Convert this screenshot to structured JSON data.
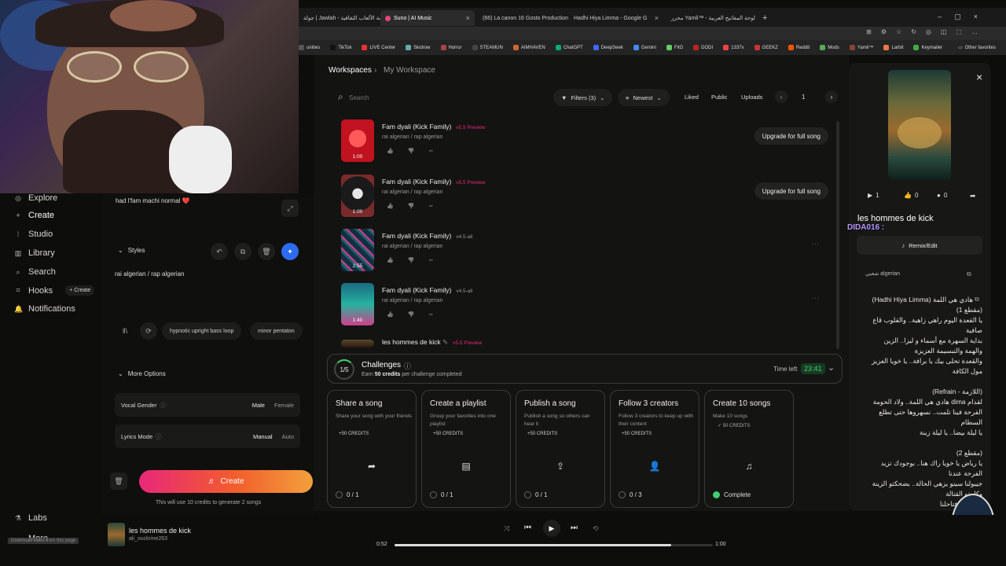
{
  "browser": {
    "tabs": [
      {
        "label": "جولة | Jawlah - منصة الألعاب الثقافية",
        "active": false
      },
      {
        "label": "Suno | AI Music",
        "active": true
      },
      {
        "label": "(66) La canon 16 Gosto Production",
        "active": false
      },
      {
        "label": "Hadhi Hiya Limma - Google G",
        "active": false
      },
      {
        "label": "محرر Yamli™ - لوحة المفاتيح العربية",
        "active": false
      }
    ],
    "bookmarks": [
      "unities",
      "TikTok",
      "LIVE Center",
      "Skidrow",
      "Horror",
      "STEAMUN",
      "AIMHAVEN",
      "ChatGPT",
      "DeepSeek",
      "Gemini",
      "FitG",
      "DODI",
      "1337x",
      "GEEKZ",
      "Reddit",
      "Mods",
      "Yamli™",
      "Larbit",
      "Keymailer"
    ],
    "bookmark_other": "Other favorites"
  },
  "nav": {
    "items": [
      {
        "label": "Explore",
        "icon": "compass-icon"
      },
      {
        "label": "Create",
        "icon": "plus-icon"
      },
      {
        "label": "Studio",
        "icon": "sliders-icon"
      },
      {
        "label": "Library",
        "icon": "library-icon"
      },
      {
        "label": "Search",
        "icon": "search-icon"
      },
      {
        "label": "Hooks",
        "icon": "hook-icon"
      },
      {
        "label": "Notifications",
        "icon": "bell-icon"
      }
    ],
    "hooks_create": "+ Create",
    "labs": "Labs",
    "more": "More",
    "download_hint": "Download video from this page"
  },
  "create": {
    "lyrics_snippet": "had l'fam machi normal ❤️",
    "styles_label": "Styles",
    "styles_value": "rai algerian / rap algerian",
    "tag_chips": [
      "hypnotic upright bass loop",
      "minor pentaton"
    ],
    "more_options": "More Options",
    "vocal_gender_label": "Vocal Gender",
    "vocal_male": "Male",
    "vocal_female": "Female",
    "lyrics_mode_label": "Lyrics Mode",
    "lyrics_manual": "Manual",
    "lyrics_auto": "Auto",
    "create_button": "Create",
    "credits_note": "This will use 10 credits to generate 2 songs"
  },
  "workspace": {
    "breadcrumb_root": "Workspaces",
    "breadcrumb_current": "My Workspace",
    "search_placeholder": "Search",
    "filters": "Filters (3)",
    "sort": "Newest",
    "liked": "Liked",
    "public": "Public",
    "uploads": "Uploads",
    "page": "1",
    "songs": [
      {
        "title": "Fam dyali (Kick Family)",
        "version": "v5.5 Preview",
        "genre": "rai algerian / rap algerian",
        "duration": "1:00",
        "upgrade": "Upgrade for full song"
      },
      {
        "title": "Fam dyali (Kick Family)",
        "version": "v5.5 Preview",
        "genre": "rai algerian / rap algerian",
        "duration": "1:00",
        "upgrade": "Upgrade for full song"
      },
      {
        "title": "Fam dyali (Kick Family)",
        "version": "v4.5-all",
        "genre": "rai algerian / rap algerian",
        "duration": "2:55",
        "upgrade": ""
      },
      {
        "title": "Fam dyali (Kick Family)",
        "version": "v4.5-all",
        "genre": "rai algerian / rap algerian",
        "duration": "1:40",
        "upgrade": ""
      },
      {
        "title": "les hommes de kick",
        "version": "v5.5 Preview",
        "genre": "",
        "duration": "",
        "upgrade": ""
      }
    ]
  },
  "challenges": {
    "progress": "1/5",
    "title": "Challenges",
    "subtitle_pre": "Earn ",
    "subtitle_bold": "50 credits",
    "subtitle_post": " per challenge completed",
    "time_left_label": "Time left",
    "time_left": "23:41",
    "cards": [
      {
        "title": "Share a song",
        "desc": "Share your song with your friends",
        "credits": "+50 CREDITS",
        "progress": "0 / 1",
        "icon": "share-icon",
        "glyph": "➦"
      },
      {
        "title": "Create a playlist",
        "desc": "Group your favorites into one playlist",
        "credits": "+50 CREDITS",
        "progress": "0 / 1",
        "icon": "playlist-icon",
        "glyph": "▤"
      },
      {
        "title": "Publish a song",
        "desc": "Publish a song so others can hear it",
        "credits": "+50 CREDITS",
        "progress": "0 / 1",
        "icon": "upload-icon",
        "glyph": "⇪"
      },
      {
        "title": "Follow 3 creators",
        "desc": "Follow 3 creators to keep up with their content",
        "credits": "+50 CREDITS",
        "progress": "0 / 3",
        "icon": "add-user-icon",
        "glyph": "👤"
      },
      {
        "title": "Create 10 songs",
        "desc": "Make 10 songs",
        "credits": "✓ 50 CREDITS",
        "progress": "Complete",
        "icon": "music-note-icon",
        "glyph": "♫"
      }
    ]
  },
  "detail": {
    "plays": "1",
    "likes": "0",
    "comments": "0",
    "title": "les hommes de kick",
    "overlay_user": "DIDA016 :",
    "remix": "Remix/Edit",
    "style_tag": "شعبي algerian",
    "lyrics": [
      "هادي هي اللمة (Hadhi Hiya Limma)",
      "(مقطع 1)",
      "يا القعدة اليوم راهي زاهية.. والقلوب قاع",
      "صافية",
      "بداية السهرة مع أسماء و ليزا.. الزين",
      "والهمة والتبسيمة العزيزة",
      "والقعدة تحلى بيك يا برافة.. يا خويا العزيز",
      "مول الكافة",
      "",
      "(اللازمة - Refrain)",
      "لقدام dima هادي هي اللمة.. ولاد الحومة",
      "الفرحة فينا تلمت.. نسهروها حتى تطلع",
      "السطام",
      "يا ليلة بيضا.. يا ليلة زينة",
      "",
      "(مقطع 2)",
      "يا رياض يا خويا راك هنا.. بوجودك تزيد",
      "الفرحة عندنا",
      "جيبولنا سينو يزهي الحالة.. بضحكتو الزينة",
      "وكلمتو القتالة",
      "MMA ... فتاحلنا"
    ]
  },
  "player": {
    "title": "les hommes de kick",
    "artist": "ali_ouckrine263",
    "current_time": "0:52",
    "total_time": "1:00",
    "progress": 0.87
  },
  "colors": {
    "accent_orange": "#f25d2c",
    "accent_pink": "#e8287a",
    "accent_blue": "#2d6cf0",
    "timer_green": "#3fcf6f"
  }
}
